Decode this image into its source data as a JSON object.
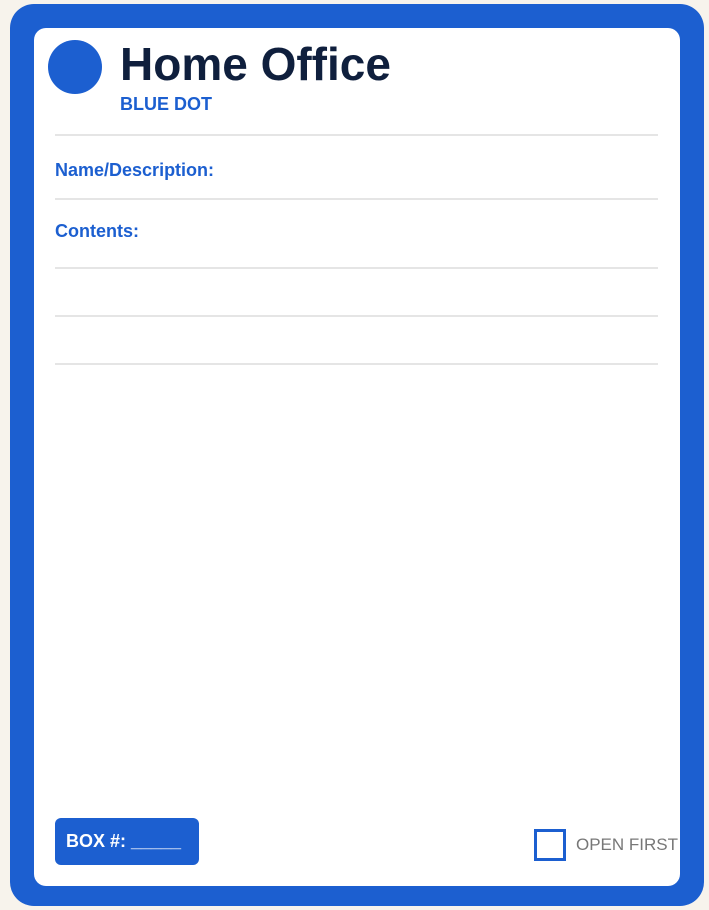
{
  "label": {
    "title": "Home Office",
    "dot_label": "BLUE DOT",
    "name_label": "Name/Description:",
    "contents_label": "Contents:",
    "box_label": "BOX #: _____",
    "open_first_label": "OPEN FIRST",
    "open_first_checked": false
  },
  "colors": {
    "accent": "#1c5fd0",
    "title": "#0f1f3d",
    "background": "#f7f3ec",
    "rule": "#e5e5e5",
    "muted": "#777777"
  }
}
